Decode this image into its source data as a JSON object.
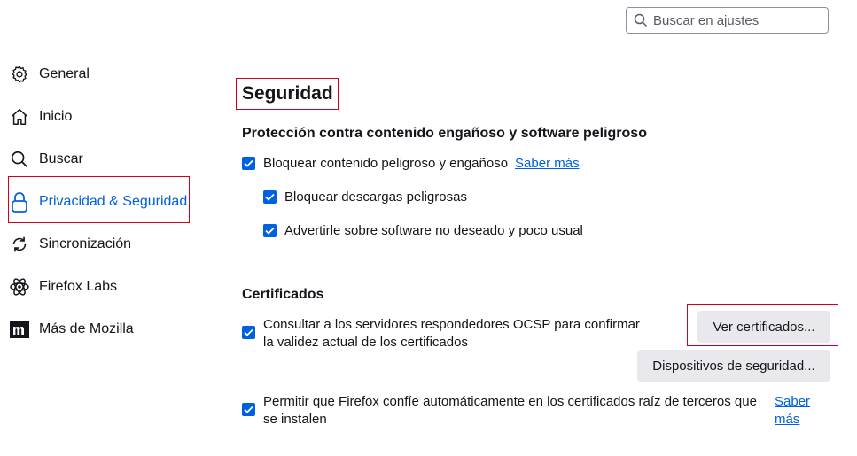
{
  "search": {
    "placeholder": "Buscar en ajustes",
    "icon": "search-icon"
  },
  "sidebar": {
    "items": [
      {
        "label": "General",
        "icon": "gear-icon"
      },
      {
        "label": "Inicio",
        "icon": "home-icon"
      },
      {
        "label": "Buscar",
        "icon": "search-icon"
      },
      {
        "label": "Privacidad & Seguridad",
        "icon": "lock-icon",
        "active": true
      },
      {
        "label": "Sincronización",
        "icon": "sync-icon"
      },
      {
        "label": "Firefox Labs",
        "icon": "atom-icon"
      },
      {
        "label": "Más de Mozilla",
        "icon": "mozilla-icon"
      }
    ]
  },
  "main": {
    "title": "Seguridad",
    "protection": {
      "heading": "Protección contra contenido engañoso y software peligroso",
      "block_label": "Bloquear contenido peligroso y engañoso",
      "learn_more": "Saber más",
      "downloads_label": "Bloquear descargas peligrosas",
      "unwanted_label": "Advertirle sobre software no deseado y poco usual"
    },
    "certificates": {
      "heading": "Certificados",
      "ocsp_line1": "Consultar a los servidores respondedores OCSP para confirmar",
      "ocsp_line2": "la validez actual de los certificados",
      "view_button": "Ver certificados...",
      "devices_button": "Dispositivos de seguridad...",
      "thirdparty_line1": "Permitir que Firefox confíe automáticamente en los certificados raíz de terceros que",
      "thirdparty_line2": "se instalen",
      "learn_more_1": "Saber",
      "learn_more_2": "más"
    }
  },
  "colors": {
    "accent": "#0061e0",
    "highlight": "#d0021b"
  }
}
